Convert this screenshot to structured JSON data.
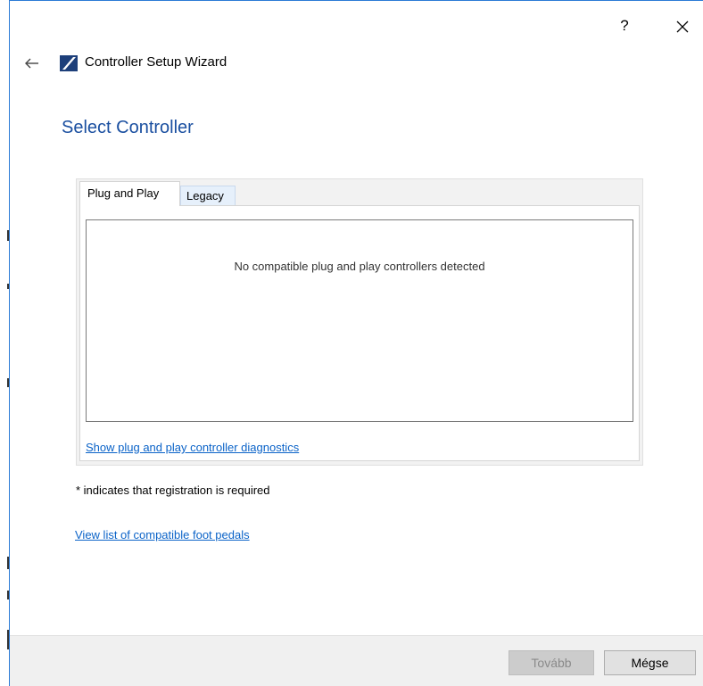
{
  "window": {
    "title": "Controller Setup Wizard",
    "help_label": "?"
  },
  "page": {
    "heading": "Select Controller"
  },
  "tabs": [
    {
      "label": "Plug and Play",
      "active": true
    },
    {
      "label": "Legacy",
      "active": false
    }
  ],
  "plug_and_play": {
    "empty_message": "No compatible plug and play controllers detected",
    "diagnostics_link": "Show plug and play controller diagnostics"
  },
  "notes": {
    "registration": "* indicates that registration is required",
    "pedals_link": "View list of compatible foot pedals"
  },
  "footer": {
    "next_label": "Tovább",
    "cancel_label": "Mégse"
  },
  "colors": {
    "accent": "#1a4fa0",
    "link": "#0b63c8",
    "window_border": "#2b7bd6"
  },
  "icons": {
    "back": "arrow-left-icon",
    "app": "app-logo-icon",
    "close": "close-icon"
  }
}
